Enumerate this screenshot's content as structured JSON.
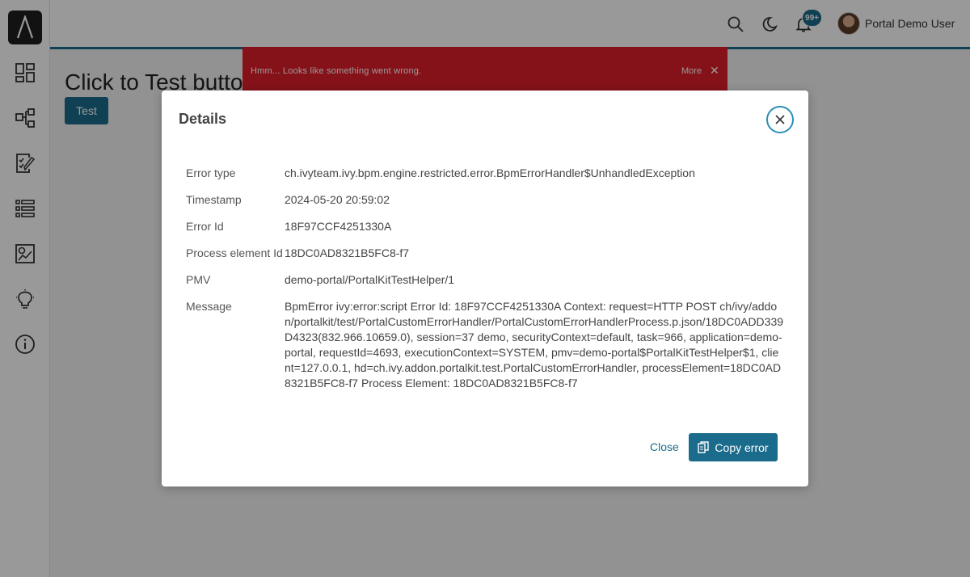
{
  "app": {
    "user_name": "Portal Demo User",
    "notification_badge": "99+"
  },
  "page": {
    "title": "Click to Test button",
    "test_button_label": "Test"
  },
  "growl": {
    "message": "Hmm... Looks like something went wrong.",
    "more_label": "More",
    "close_glyph": "✕",
    "color": "#e01f2a"
  },
  "dialog": {
    "title": "Details",
    "rows": [
      {
        "label": "Error type",
        "value": "ch.ivyteam.ivy.bpm.engine.restricted.error.BpmErrorHandler$UnhandledException"
      },
      {
        "label": "Timestamp",
        "value": "2024-05-20 20:59:02"
      },
      {
        "label": "Error Id",
        "value": "18F97CCF4251330A"
      },
      {
        "label": "Process element Id",
        "value": "18DC0AD8321B5FC8-f7"
      },
      {
        "label": "PMV",
        "value": "demo-portal/PortalKitTestHelper/1"
      },
      {
        "label": "Message",
        "value": "BpmError ivy:error:script Error Id: 18F97CCF4251330A Context: request=HTTP POST ch/ivy/addon/portalkit/test/PortalCustomErrorHandler/PortalCustomErrorHandlerProcess.p.json/18DC0ADD339D4323(832.966.10659.0), session=37 demo, securityContext=default, task=966, application=demo-portal, requestId=4693, executionContext=SYSTEM, pmv=demo-portal$PortalKitTestHelper$1, client=127.0.0.1, hd=ch.ivy.addon.portalkit.test.PortalCustomErrorHandler, processElement=18DC0AD8321B5FC8-f7 Process Element: 18DC0AD8321B5FC8-f7"
      }
    ],
    "close_label": "Close",
    "copy_label": "Copy error"
  },
  "icons": {
    "sidebar": [
      "dashboard-icon",
      "processes-icon",
      "tasks-icon",
      "cases-icon",
      "statistics-icon",
      "ideas-icon",
      "info-icon"
    ],
    "topbar": [
      "search-icon",
      "dark-mode-icon",
      "notification-bell-icon"
    ]
  },
  "colors": {
    "primary": "#1b6b8c",
    "close_ring": "#2a90b5",
    "error": "#e01f2a"
  }
}
